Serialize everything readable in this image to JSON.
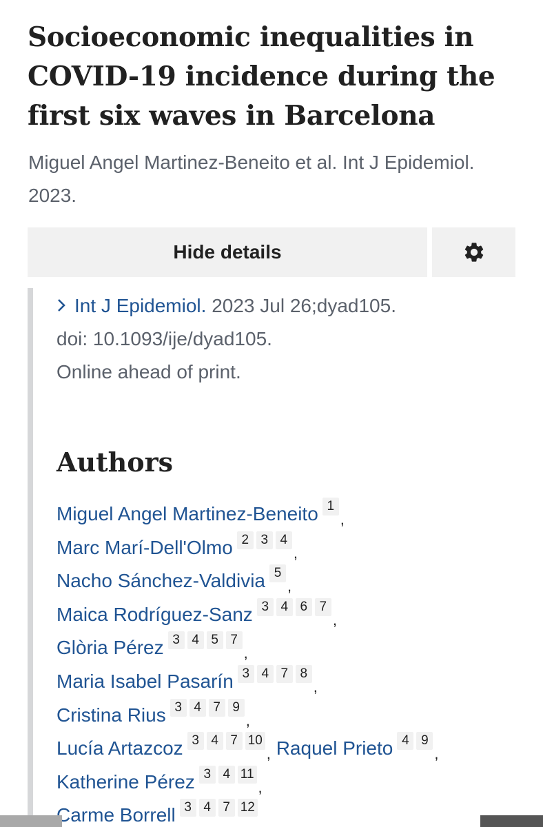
{
  "article": {
    "title": "Socioeconomic inequalities in COVID-19 incidence during the first six waves in Barcelona",
    "citation_summary": "Miguel Angel Martinez-Beneito et al. Int J Epidemiol. 2023."
  },
  "controls": {
    "details_button": "Hide details",
    "settings_icon": "gear-icon"
  },
  "details": {
    "journal": "Int J Epidemiol.",
    "date_issue": " 2023 Jul 26;dyad105.",
    "doi": "doi: 10.1093/ije/dyad105.",
    "status": "Online ahead of print."
  },
  "authors_heading": "Authors",
  "authors": [
    {
      "name": "Miguel Angel Martinez-Beneito",
      "affs": [
        "1"
      ]
    },
    {
      "name": "Marc Marí-Dell'Olmo",
      "affs": [
        "2",
        "3",
        "4"
      ]
    },
    {
      "name": "Nacho Sánchez-Valdivia",
      "affs": [
        "5"
      ]
    },
    {
      "name": "Maica Rodríguez-Sanz",
      "affs": [
        "3",
        "4",
        "6",
        "7"
      ]
    },
    {
      "name": "Glòria Pérez",
      "affs": [
        "3",
        "4",
        "5",
        "7"
      ]
    },
    {
      "name": "Maria Isabel Pasarín",
      "affs": [
        "3",
        "4",
        "7",
        "8"
      ]
    },
    {
      "name": "Cristina Rius",
      "affs": [
        "3",
        "4",
        "7",
        "9"
      ]
    },
    {
      "name": "Lucía Artazcoz",
      "affs": [
        "3",
        "4",
        "7",
        "10"
      ]
    },
    {
      "name": "Raquel Prieto",
      "affs": [
        "4",
        "9"
      ]
    },
    {
      "name": "Katherine Pérez",
      "affs": [
        "3",
        "4",
        "11"
      ]
    },
    {
      "name": "Carme Borrell",
      "affs": [
        "3",
        "4",
        "7",
        "12"
      ]
    }
  ],
  "author_lines": [
    [
      0
    ],
    [
      1
    ],
    [
      2
    ],
    [
      3
    ],
    [
      4
    ],
    [
      5
    ],
    [
      6
    ],
    [
      7,
      8
    ],
    [
      9
    ],
    [
      10
    ]
  ],
  "colors": {
    "link": "#205493",
    "muted_text": "#5b616b",
    "button_bg": "#f1f1f1",
    "border": "#d6d7d9"
  }
}
